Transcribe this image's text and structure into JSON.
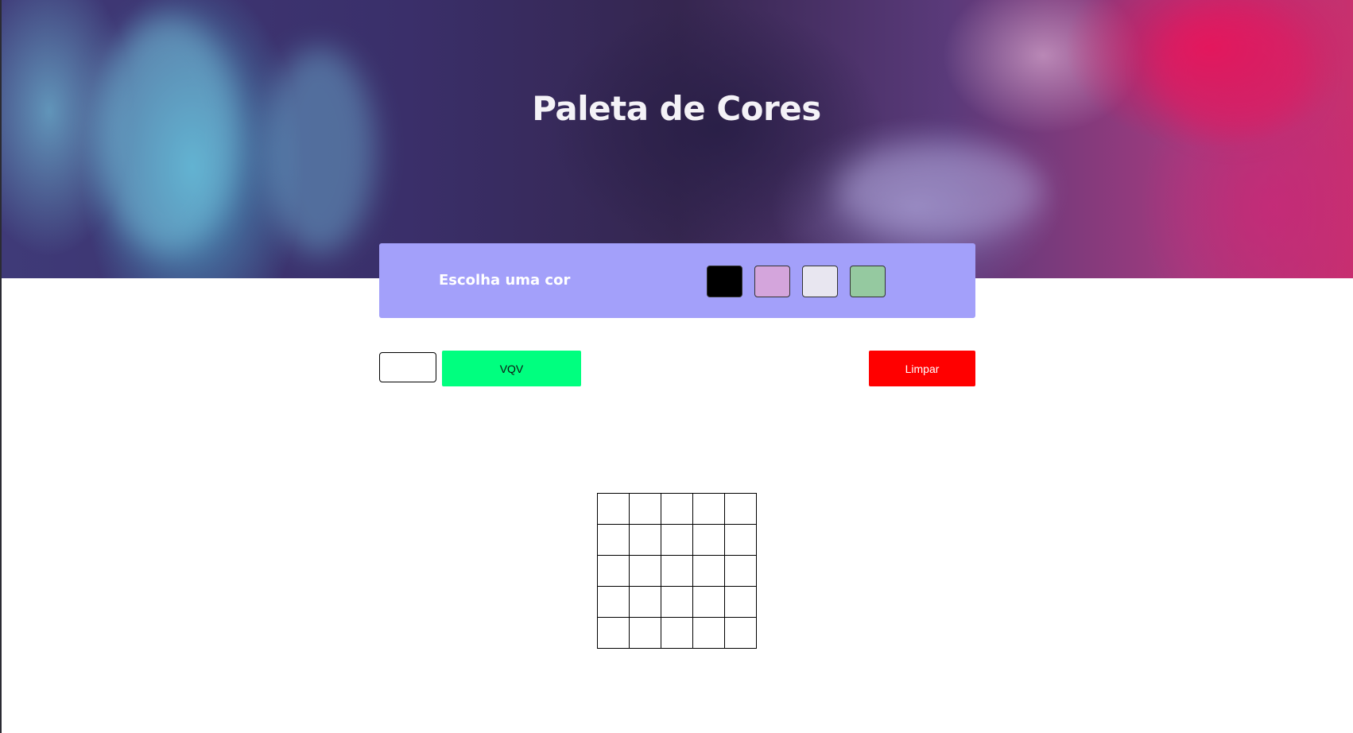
{
  "page": {
    "title": "Paleta de Cores"
  },
  "palette": {
    "label": "Escolha uma cor",
    "colors": [
      {
        "name": "black",
        "hex": "#000000"
      },
      {
        "name": "lilac",
        "hex": "#d4a5dc"
      },
      {
        "name": "light-lavender",
        "hex": "#e8e6f0"
      },
      {
        "name": "sage-green",
        "hex": "#95c9a0"
      }
    ],
    "background": "#a3a0fa"
  },
  "controls": {
    "board_size_value": "",
    "generate_label": "VQV",
    "generate_color": "#00ff7f",
    "clear_label": "Limpar",
    "clear_color": "#ff0000"
  },
  "board": {
    "rows": 5,
    "columns": 5,
    "cell_color": "#ffffff"
  }
}
